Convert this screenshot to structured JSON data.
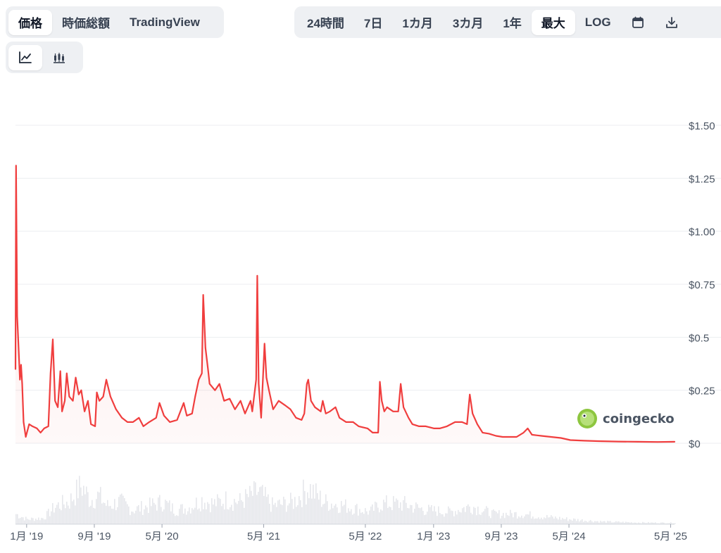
{
  "tabs": {
    "left": [
      "価格",
      "時価総額",
      "TradingView"
    ],
    "left_active": 0,
    "range": [
      "24時間",
      "7日",
      "1カ月",
      "3カ月",
      "1年",
      "最大",
      "LOG"
    ],
    "range_active": 5
  },
  "icons": {
    "calendar": "calendar-icon",
    "download": "download-icon",
    "line": "line-chart-icon",
    "candle": "candlestick-icon"
  },
  "watermark": {
    "text": "coingecko"
  },
  "colors": {
    "line": "#f03e3e",
    "fill": "#fde8e8",
    "volume": "#e5e7eb",
    "grid": "#eceef1",
    "axis_text": "#4b5563"
  },
  "chart_data": {
    "type": "line",
    "ylim": [
      0,
      1.5
    ],
    "y_ticks": [
      {
        "v": 1.5,
        "label": "$1.50"
      },
      {
        "v": 1.25,
        "label": "$1.25"
      },
      {
        "v": 1.0,
        "label": "$1.00"
      },
      {
        "v": 0.75,
        "label": "$0.75"
      },
      {
        "v": 0.5,
        "label": "$0.5"
      },
      {
        "v": 0.25,
        "label": "$0.25"
      },
      {
        "v": 0,
        "label": "$0"
      }
    ],
    "xlim": [
      "2018-11-22",
      "2025-05-15"
    ],
    "x_ticks": [
      {
        "date": "2019-01-01",
        "label": "1月 '19"
      },
      {
        "date": "2019-09-01",
        "label": "9月 '19"
      },
      {
        "date": "2020-05-01",
        "label": "5月 '20"
      },
      {
        "date": "2021-05-01",
        "label": "5月 '21"
      },
      {
        "date": "2022-05-01",
        "label": "5月 '22"
      },
      {
        "date": "2023-01-01",
        "label": "1月 '23"
      },
      {
        "date": "2023-09-01",
        "label": "9月 '23"
      },
      {
        "date": "2024-05-01",
        "label": "5月 '24"
      },
      {
        "date": "2025-05-01",
        "label": "5月 '25"
      }
    ],
    "series": [
      {
        "points": [
          [
            "2018-11-22",
            0.35
          ],
          [
            "2018-11-24",
            1.31
          ],
          [
            "2018-11-28",
            0.6
          ],
          [
            "2018-12-03",
            0.45
          ],
          [
            "2018-12-08",
            0.3
          ],
          [
            "2018-12-12",
            0.37
          ],
          [
            "2018-12-16",
            0.28
          ],
          [
            "2018-12-21",
            0.1
          ],
          [
            "2018-12-29",
            0.03
          ],
          [
            "2019-01-10",
            0.09
          ],
          [
            "2019-01-22",
            0.08
          ],
          [
            "2019-02-07",
            0.07
          ],
          [
            "2019-02-20",
            0.05
          ],
          [
            "2019-03-05",
            0.07
          ],
          [
            "2019-03-20",
            0.08
          ],
          [
            "2019-03-28",
            0.33
          ],
          [
            "2019-04-05",
            0.49
          ],
          [
            "2019-04-13",
            0.2
          ],
          [
            "2019-04-23",
            0.17
          ],
          [
            "2019-05-02",
            0.34
          ],
          [
            "2019-05-08",
            0.15
          ],
          [
            "2019-05-18",
            0.2
          ],
          [
            "2019-05-25",
            0.33
          ],
          [
            "2019-06-03",
            0.22
          ],
          [
            "2019-06-16",
            0.2
          ],
          [
            "2019-06-26",
            0.31
          ],
          [
            "2019-07-07",
            0.23
          ],
          [
            "2019-07-16",
            0.25
          ],
          [
            "2019-07-28",
            0.15
          ],
          [
            "2019-08-09",
            0.2
          ],
          [
            "2019-08-20",
            0.09
          ],
          [
            "2019-09-04",
            0.08
          ],
          [
            "2019-09-10",
            0.24
          ],
          [
            "2019-09-19",
            0.2
          ],
          [
            "2019-10-03",
            0.22
          ],
          [
            "2019-10-14",
            0.3
          ],
          [
            "2019-10-29",
            0.22
          ],
          [
            "2019-11-18",
            0.16
          ],
          [
            "2019-12-09",
            0.12
          ],
          [
            "2019-12-29",
            0.1
          ],
          [
            "2020-01-18",
            0.1
          ],
          [
            "2020-02-08",
            0.12
          ],
          [
            "2020-02-24",
            0.08
          ],
          [
            "2020-03-16",
            0.1
          ],
          [
            "2020-04-10",
            0.12
          ],
          [
            "2020-04-22",
            0.19
          ],
          [
            "2020-05-08",
            0.13
          ],
          [
            "2020-05-29",
            0.1
          ],
          [
            "2020-06-24",
            0.11
          ],
          [
            "2020-07-18",
            0.19
          ],
          [
            "2020-07-29",
            0.13
          ],
          [
            "2020-08-17",
            0.14
          ],
          [
            "2020-08-28",
            0.22
          ],
          [
            "2020-09-10",
            0.3
          ],
          [
            "2020-09-21",
            0.33
          ],
          [
            "2020-09-26",
            0.7
          ],
          [
            "2020-10-04",
            0.45
          ],
          [
            "2020-10-13",
            0.35
          ],
          [
            "2020-10-19",
            0.28
          ],
          [
            "2020-11-07",
            0.25
          ],
          [
            "2020-11-23",
            0.28
          ],
          [
            "2020-12-10",
            0.2
          ],
          [
            "2020-12-30",
            0.21
          ],
          [
            "2021-01-18",
            0.16
          ],
          [
            "2021-02-07",
            0.2
          ],
          [
            "2021-02-23",
            0.14
          ],
          [
            "2021-03-15",
            0.2
          ],
          [
            "2021-03-21",
            0.15
          ],
          [
            "2021-04-04",
            0.3
          ],
          [
            "2021-04-08",
            0.79
          ],
          [
            "2021-04-13",
            0.28
          ],
          [
            "2021-04-22",
            0.12
          ],
          [
            "2021-05-04",
            0.47
          ],
          [
            "2021-05-11",
            0.31
          ],
          [
            "2021-05-20",
            0.25
          ],
          [
            "2021-06-04",
            0.16
          ],
          [
            "2021-06-24",
            0.2
          ],
          [
            "2021-07-16",
            0.18
          ],
          [
            "2021-08-05",
            0.16
          ],
          [
            "2021-08-25",
            0.12
          ],
          [
            "2021-09-14",
            0.11
          ],
          [
            "2021-09-24",
            0.14
          ],
          [
            "2021-10-03",
            0.28
          ],
          [
            "2021-10-08",
            0.3
          ],
          [
            "2021-10-18",
            0.2
          ],
          [
            "2021-11-01",
            0.17
          ],
          [
            "2021-11-22",
            0.15
          ],
          [
            "2021-11-29",
            0.2
          ],
          [
            "2021-12-10",
            0.14
          ],
          [
            "2021-12-25",
            0.15
          ],
          [
            "2022-01-14",
            0.17
          ],
          [
            "2022-01-28",
            0.12
          ],
          [
            "2022-02-21",
            0.1
          ],
          [
            "2022-03-18",
            0.1
          ],
          [
            "2022-04-07",
            0.08
          ],
          [
            "2022-05-09",
            0.07
          ],
          [
            "2022-05-27",
            0.05
          ],
          [
            "2022-06-16",
            0.05
          ],
          [
            "2022-06-22",
            0.29
          ],
          [
            "2022-06-29",
            0.2
          ],
          [
            "2022-07-08",
            0.15
          ],
          [
            "2022-07-18",
            0.17
          ],
          [
            "2022-08-09",
            0.15
          ],
          [
            "2022-08-27",
            0.15
          ],
          [
            "2022-09-05",
            0.28
          ],
          [
            "2022-09-15",
            0.17
          ],
          [
            "2022-10-03",
            0.12
          ],
          [
            "2022-10-17",
            0.09
          ],
          [
            "2022-11-10",
            0.08
          ],
          [
            "2022-12-04",
            0.08
          ],
          [
            "2023-01-03",
            0.07
          ],
          [
            "2023-01-23",
            0.07
          ],
          [
            "2023-02-18",
            0.08
          ],
          [
            "2023-03-19",
            0.1
          ],
          [
            "2023-04-13",
            0.1
          ],
          [
            "2023-05-01",
            0.09
          ],
          [
            "2023-05-11",
            0.23
          ],
          [
            "2023-05-21",
            0.14
          ],
          [
            "2023-06-07",
            0.09
          ],
          [
            "2023-06-26",
            0.05
          ],
          [
            "2023-07-19",
            0.045
          ],
          [
            "2023-08-13",
            0.035
          ],
          [
            "2023-09-06",
            0.03
          ],
          [
            "2023-10-01",
            0.03
          ],
          [
            "2023-10-26",
            0.03
          ],
          [
            "2023-11-20",
            0.05
          ],
          [
            "2023-12-05",
            0.07
          ],
          [
            "2023-12-20",
            0.04
          ],
          [
            "2024-01-23",
            0.035
          ],
          [
            "2024-02-27",
            0.03
          ],
          [
            "2024-04-02",
            0.025
          ],
          [
            "2024-05-06",
            0.015
          ],
          [
            "2024-06-25",
            0.012
          ],
          [
            "2024-08-14",
            0.01
          ],
          [
            "2024-10-27",
            0.008
          ],
          [
            "2025-01-04",
            0.007
          ],
          [
            "2025-03-15",
            0.006
          ],
          [
            "2025-05-15",
            0.007
          ]
        ]
      }
    ],
    "volume": [
      [
        "2018-11-22",
        0.25
      ],
      [
        "2019-01-01",
        0.12
      ],
      [
        "2019-03-01",
        0.15
      ],
      [
        "2019-04-15",
        0.45
      ],
      [
        "2019-06-01",
        0.55
      ],
      [
        "2019-07-15",
        0.95
      ],
      [
        "2019-08-15",
        0.6
      ],
      [
        "2019-09-15",
        0.7
      ],
      [
        "2019-10-15",
        0.45
      ],
      [
        "2019-12-01",
        0.55
      ],
      [
        "2020-01-15",
        0.35
      ],
      [
        "2020-03-15",
        0.45
      ],
      [
        "2020-05-01",
        0.55
      ],
      [
        "2020-06-15",
        0.35
      ],
      [
        "2020-08-01",
        0.4
      ],
      [
        "2020-09-20",
        0.6
      ],
      [
        "2020-11-01",
        0.5
      ],
      [
        "2020-12-15",
        0.6
      ],
      [
        "2021-02-01",
        0.55
      ],
      [
        "2021-04-10",
        0.8
      ],
      [
        "2021-06-01",
        0.45
      ],
      [
        "2021-08-15",
        0.55
      ],
      [
        "2021-10-08",
        0.9
      ],
      [
        "2021-12-01",
        0.55
      ],
      [
        "2022-02-15",
        0.45
      ],
      [
        "2022-05-15",
        0.3
      ],
      [
        "2022-06-25",
        0.5
      ],
      [
        "2022-09-10",
        0.5
      ],
      [
        "2022-12-01",
        0.35
      ],
      [
        "2023-03-01",
        0.3
      ],
      [
        "2023-05-15",
        0.45
      ],
      [
        "2023-08-01",
        0.25
      ],
      [
        "2023-11-15",
        0.25
      ],
      [
        "2024-02-01",
        0.18
      ],
      [
        "2024-05-01",
        0.12
      ],
      [
        "2024-09-01",
        0.06
      ],
      [
        "2025-01-01",
        0.04
      ],
      [
        "2025-05-15",
        0.03
      ]
    ]
  }
}
